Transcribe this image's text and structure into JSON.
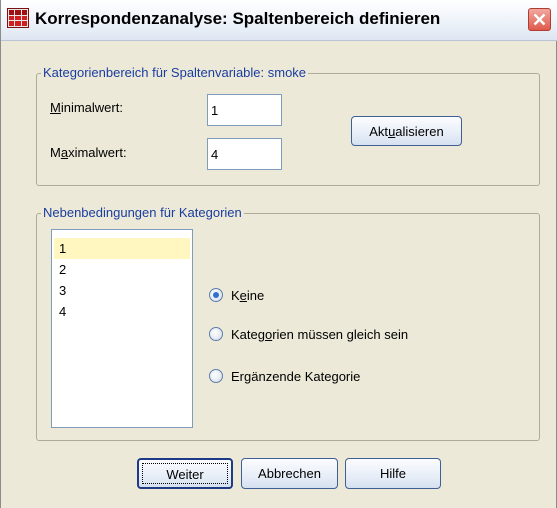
{
  "window": {
    "title": "Korrespondenzanalyse: Spaltenbereich definieren"
  },
  "range_group": {
    "legend": "Kategorienbereich für Spaltenvariable:  smoke",
    "min": {
      "mn": "M",
      "rest": "inimalwert:",
      "value": "1"
    },
    "max": {
      "pre": "M",
      "mn": "a",
      "rest": "ximalwert:",
      "value": "4"
    },
    "update": {
      "pre": "Akt",
      "mn": "u",
      "rest": "alisieren"
    }
  },
  "constraints_group": {
    "legend": "Nebenbedingungen für Kategorien",
    "categories": [
      "1",
      "2",
      "3",
      "4"
    ],
    "selected_category": "1",
    "options": {
      "none": {
        "pre": "K",
        "mn": "e",
        "rest": "ine",
        "selected": true
      },
      "equal": {
        "pre": "Kateg",
        "mn": "o",
        "rest": "rien müssen gleich sein",
        "selected": false
      },
      "supplementary": {
        "pre": "Er",
        "mn": "g",
        "rest": "änzende Kategorie",
        "selected": false
      }
    }
  },
  "buttons": {
    "continue": "Weiter",
    "cancel": "Abbrechen",
    "help": "Hilfe"
  }
}
